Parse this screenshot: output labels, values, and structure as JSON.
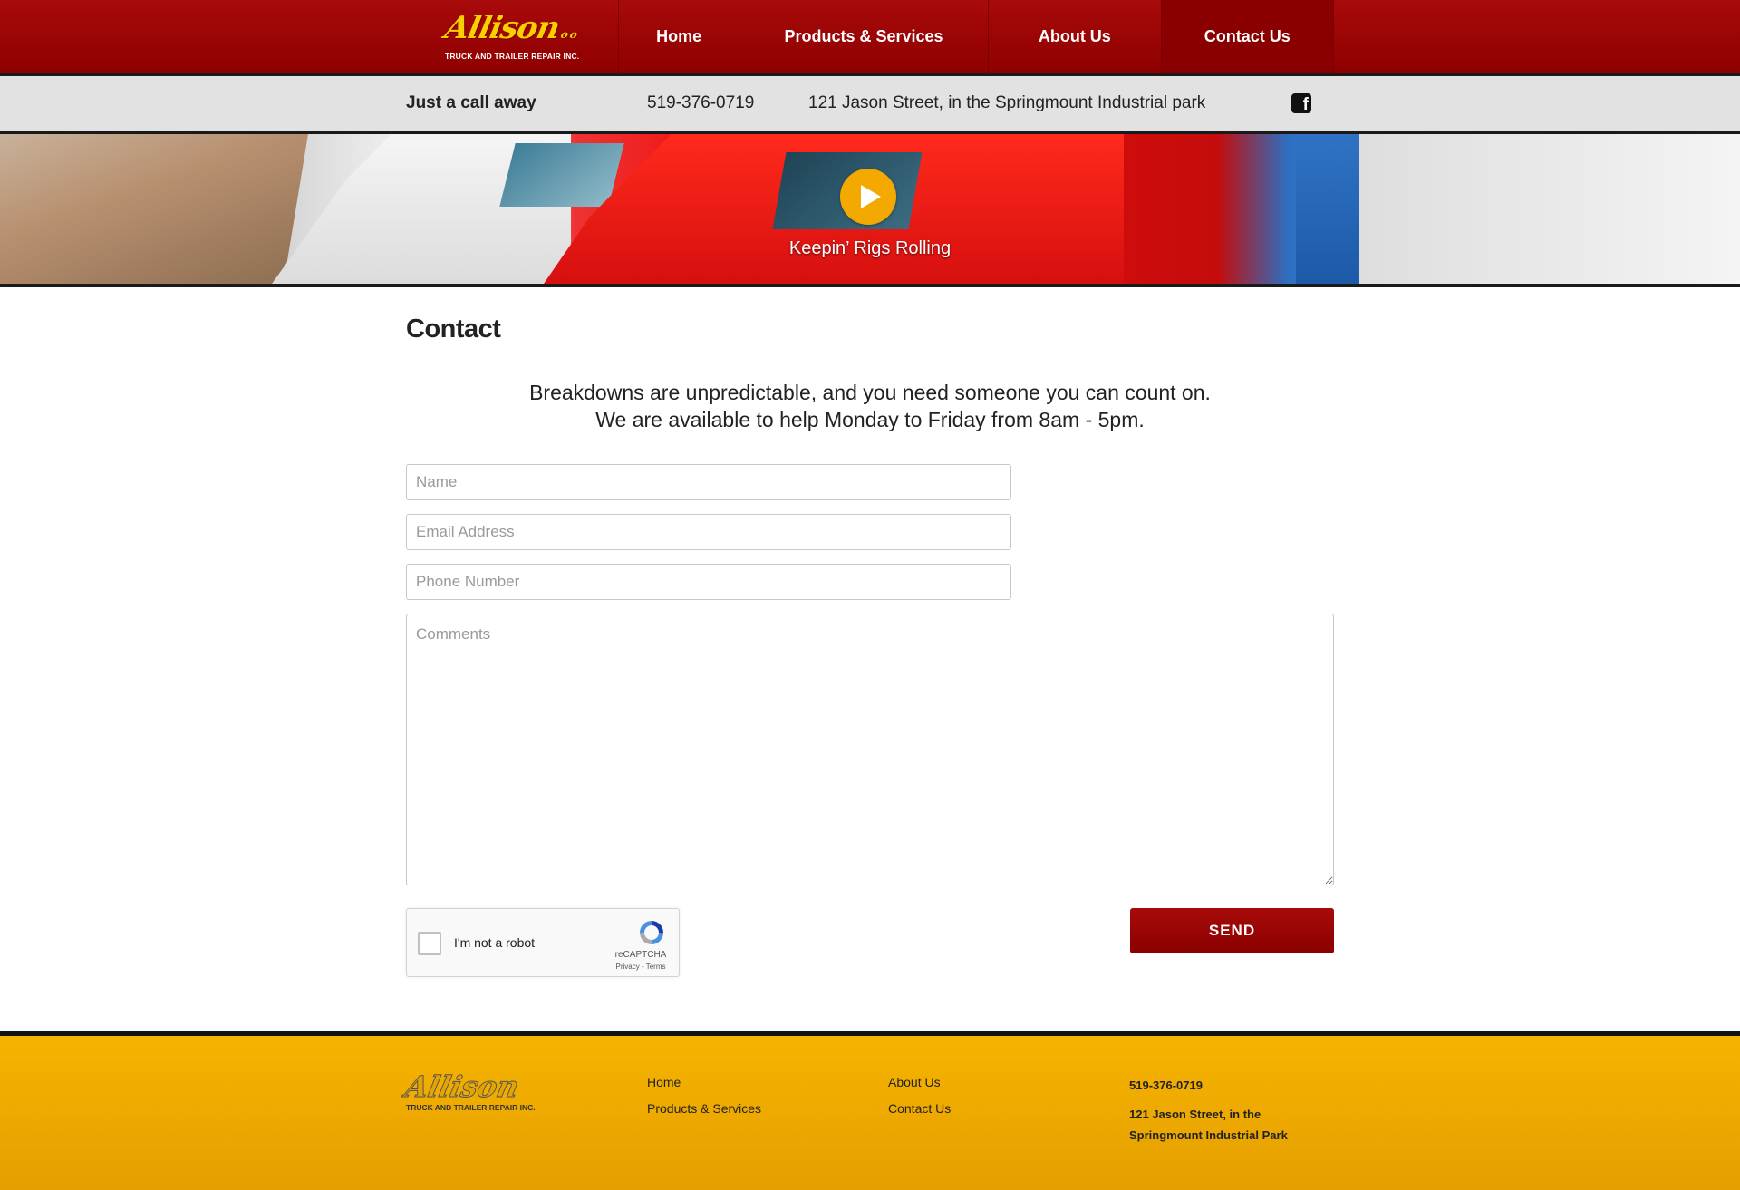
{
  "brand": {
    "logo_script": "Allison",
    "logo_tagline": "TRUCK AND TRAILER REPAIR INC."
  },
  "nav": {
    "home": "Home",
    "products": "Products & Services",
    "about": "About Us",
    "contact": "Contact Us",
    "active": "Contact Us"
  },
  "info_bar": {
    "tagline": "Just a call away",
    "phone": "519-376-0719",
    "address": "121 Jason Street, in the Springmount Industrial park",
    "social_icon": "facebook-icon"
  },
  "hero": {
    "caption": "Keepin’ Rigs Rolling",
    "play_icon": "play-icon",
    "play_color": "#f4a900"
  },
  "contact": {
    "title": "Contact",
    "intro_line1": "Breakdowns are unpredictable, and you need someone you can count on.",
    "intro_line2": "We are available to help Monday to Friday from 8am - 5pm.",
    "name_placeholder": "Name",
    "email_placeholder": "Email Address",
    "phone_placeholder": "Phone Number",
    "comments_placeholder": "Comments",
    "captcha_label": "I'm not a robot",
    "captcha_brand": "reCAPTCHA",
    "captcha_links": "Privacy - Terms",
    "send_label": "SEND"
  },
  "footer": {
    "logo_script": "Allison",
    "logo_tagline": "TRUCK AND TRAILER REPAIR INC.",
    "links_col1": [
      "Home",
      "Products & Services"
    ],
    "links_col2": [
      "About Us",
      "Contact Us"
    ],
    "phone": "519-376-0719",
    "address": "121 Jason Street, in the Springmount Industrial Park"
  },
  "colors": {
    "primary_red": "#a80a0a",
    "footer_gold": "#f6b400",
    "info_bar_gray": "#e2e2e2"
  }
}
